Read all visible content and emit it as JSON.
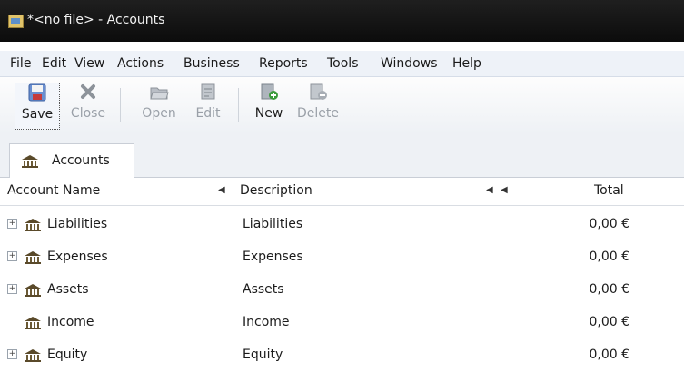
{
  "window": {
    "title": "*<no file> - Accounts"
  },
  "menu": [
    "File",
    "Edit",
    "View",
    "Actions",
    "Business",
    "Reports",
    "Tools",
    "Windows",
    "Help"
  ],
  "toolbar": {
    "save": "Save",
    "close": "Close",
    "open": "Open",
    "edit": "Edit",
    "new": "New",
    "delete": "Delete"
  },
  "tabs": [
    {
      "label": "Accounts",
      "icon": "bank-icon"
    }
  ],
  "table": {
    "columns": [
      "Account Name",
      "Description",
      "Total"
    ],
    "rows": [
      {
        "name": "Liabilities",
        "description": "Liabilities",
        "total": "0,00 €",
        "expandable": true
      },
      {
        "name": "Expenses",
        "description": "Expenses",
        "total": "0,00 €",
        "expandable": true
      },
      {
        "name": "Assets",
        "description": "Assets",
        "total": "0,00 €",
        "expandable": true
      },
      {
        "name": "Income",
        "description": "Income",
        "total": "0,00 €",
        "expandable": false
      },
      {
        "name": "Equity",
        "description": "Equity",
        "total": "0,00 €",
        "expandable": true
      }
    ]
  },
  "colors": {
    "titlebar": "#111111",
    "menubar": "#eef2f8",
    "toolbar": "#f5f7fa",
    "disabled_text": "#9aa0a8"
  },
  "icons": [
    "app-icon",
    "save-icon",
    "close-icon",
    "open-icon",
    "edit-icon",
    "new-icon",
    "delete-icon",
    "bank-icon",
    "expander-icon"
  ]
}
